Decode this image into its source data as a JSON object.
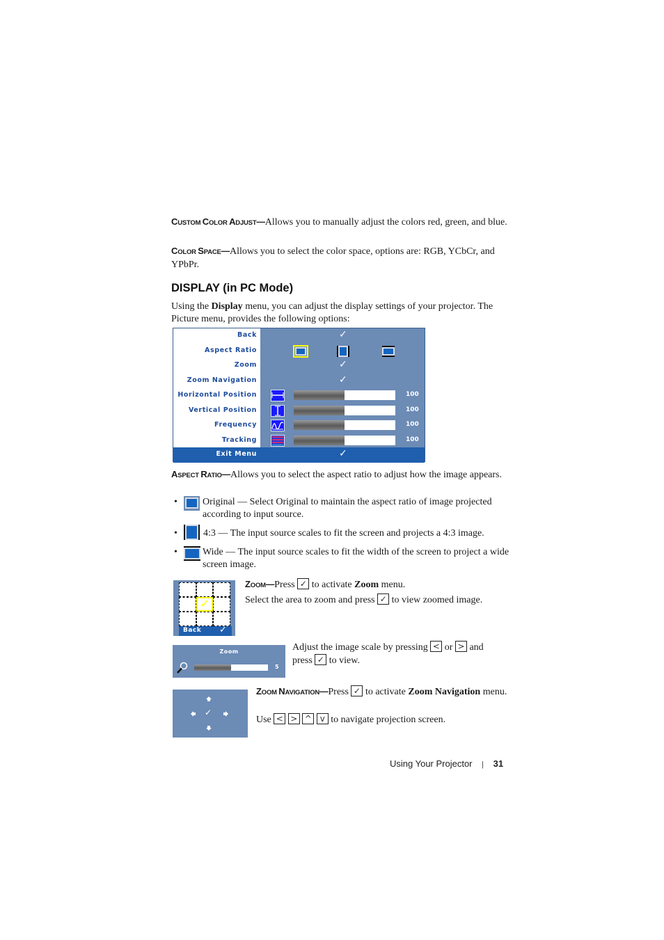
{
  "paragraphs": {
    "custom_color_adjust": {
      "term_first": "C",
      "term_rest": "USTOM ",
      "term2_first": "C",
      "term2_rest": "OLOR ",
      "term3_first": "A",
      "term3_rest": "DJUST",
      "dash": "—",
      "text": "Allows you to manually adjust the colors red, green, and blue."
    },
    "color_space": {
      "term_first": "C",
      "term_rest": "OLOR ",
      "term2_first": "S",
      "term2_rest": "PACE",
      "dash": "—",
      "text": "Allows you to select the color space, options are: RGB, YCbCr, and YPbPr."
    }
  },
  "section": {
    "title": "DISPLAY (in PC Mode)",
    "intro_before": "Using the ",
    "intro_bold": "Display",
    "intro_after": " menu, you can adjust the display settings of your projector. The Picture menu, provides the following options:"
  },
  "osd_menu": {
    "colors": {
      "panel": "#6c8bb5",
      "label_text": "#1e4c9c",
      "highlight": "#1f5fae",
      "selection": "#ffff00"
    },
    "rows": [
      {
        "label": "Back",
        "control": "check",
        "check": "✓"
      },
      {
        "label": "Aspect Ratio",
        "control": "aspect",
        "options": [
          "original",
          "4:3",
          "wide"
        ],
        "selected": "original"
      },
      {
        "label": "Zoom",
        "control": "check",
        "check": "✓"
      },
      {
        "label": "Zoom Navigation",
        "control": "check",
        "check": "✓"
      },
      {
        "label": "Horizontal Position",
        "control": "slider",
        "icon": "horizontal-position-icon",
        "value": "100",
        "fill_fraction": 0.5
      },
      {
        "label": "Vertical Position",
        "control": "slider",
        "icon": "vertical-position-icon",
        "value": "100",
        "fill_fraction": 0.5
      },
      {
        "label": "Frequency",
        "control": "slider",
        "icon": "frequency-icon",
        "value": "100",
        "fill_fraction": 0.5
      },
      {
        "label": "Tracking",
        "control": "slider",
        "icon": "tracking-icon",
        "value": "100",
        "fill_fraction": 0.5
      },
      {
        "label": "Exit Menu",
        "control": "check",
        "check": "✓",
        "highlighted": true
      }
    ]
  },
  "aspect_ratio": {
    "term_first": "A",
    "term_rest": "SPECT ",
    "term2_first": "R",
    "term2_rest": "ATIO",
    "dash": "—",
    "text": "Allows you to select the aspect ratio to adjust how the image appears.",
    "bullets": [
      {
        "icon": "original-aspect-icon",
        "text": "Original — Select Original to maintain the aspect ratio of image projected according to input source."
      },
      {
        "icon": "4-3-aspect-icon",
        "text": "4:3 — The input source scales to fit the screen and projects a 4:3 image."
      },
      {
        "icon": "wide-aspect-icon",
        "text": "Wide — The input source scales to fit the width of the screen to project a wide screen image."
      }
    ]
  },
  "zoom": {
    "term_first": "Z",
    "term_rest": "OOM",
    "dash": "—",
    "line1_before": "Press ",
    "line1_after": " to activate ",
    "line1_bold": "Zoom",
    "line1_end": " menu.",
    "line2_before": "Select the area to zoom and press ",
    "line2_after": " to view zoomed image.",
    "grid_back_label": "Back",
    "grid_check": "✓",
    "scale_before": "Adjust the image scale by pressing ",
    "scale_or": " or ",
    "scale_and": " and",
    "scale_press": "press ",
    "scale_view": " to view.",
    "osd_title": "Zoom",
    "osd_value": "5",
    "osd_fill_fraction": 0.5
  },
  "zoom_navigation": {
    "term_first": "Z",
    "term_rest": "OOM ",
    "term2_first": "N",
    "term2_rest": "AVIGATION",
    "dash": "—",
    "line1_before": "Press ",
    "line1_after": " to activate ",
    "line1_bold": "Zoom Navigation",
    "line1_end": " menu.",
    "line2_before": "Use ",
    "line2_after": " to navigate projection screen.",
    "check": "✓"
  },
  "buttons": {
    "left": "<",
    "right": ">",
    "up": "^",
    "down": "v",
    "select": "✓"
  },
  "footer": {
    "chapter": "Using Your Projector",
    "separator": "|",
    "page_number": "31"
  }
}
